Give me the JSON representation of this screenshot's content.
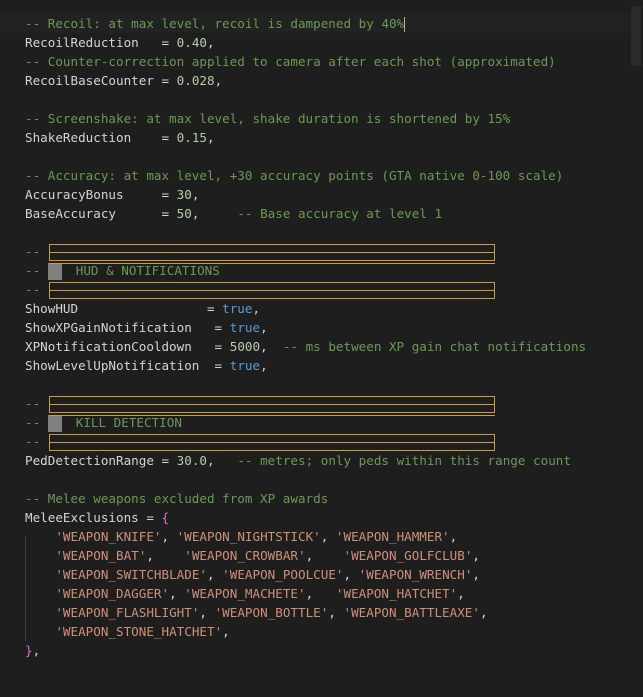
{
  "lines": {
    "l1": "-- Recoil: at max level, recoil is dampened by 40%",
    "l2_key": "RecoilReduction",
    "l2_eq": "   = ",
    "l2_val": "0.40",
    "l2_end": ",",
    "l3": "-- Counter-correction applied to camera after each shot (approximated)",
    "l4_key": "RecoilBaseCounter",
    "l4_eq": " = ",
    "l4_val": "0.028",
    "l4_end": ",",
    "l6": "-- Screenshake: at max level, shake duration is shortened by 15%",
    "l7_key": "ShakeReduction",
    "l7_eq": "    = ",
    "l7_val": "0.15",
    "l7_end": ",",
    "l9": "-- Accuracy: at max level, +30 accuracy points (GTA native 0-100 scale)",
    "l10_key": "AccuracyBonus",
    "l10_eq": "     = ",
    "l10_val": "30",
    "l10_end": ",",
    "l11_key": "BaseAccuracy",
    "l11_eq": "      = ",
    "l11_val": "50",
    "l11_end": ",     ",
    "l11_cm": "-- Base accuracy at level 1",
    "dash": "--",
    "hud_title": "HUD & NOTIFICATIONS",
    "l14_key": "ShowHUD",
    "l14_eq": "                 = ",
    "l14_val": "true",
    "l14_end": ",",
    "l15_key": "ShowXPGainNotification",
    "l15_eq": "   = ",
    "l15_val": "true",
    "l15_end": ",",
    "l16_key": "XPNotificationCooldown",
    "l16_eq": "   = ",
    "l16_val": "5000",
    "l16_end": ",  ",
    "l16_cm": "-- ms between XP gain chat notifications",
    "l17_key": "ShowLevelUpNotification",
    "l17_eq": "  = ",
    "l17_val": "true",
    "l17_end": ",",
    "kill_title": "KILL DETECTION",
    "l22_key": "PedDetectionRange",
    "l22_eq": " = ",
    "l22_val": "30.0",
    "l22_end": ",   ",
    "l22_cm": "-- metres; only peds within this range count",
    "l24": "-- Melee weapons excluded from XP awards",
    "l25_key": "MeleeExclusions",
    "l25_eq": " = ",
    "l25_brace": "{",
    "w1a": "'WEAPON_KNIFE'",
    "w1b": "'WEAPON_NIGHTSTICK'",
    "w1c": "'WEAPON_HAMMER'",
    "w2a": "'WEAPON_BAT'",
    "w2b": "'WEAPON_CROWBAR'",
    "w2c": "'WEAPON_GOLFCLUB'",
    "w3a": "'WEAPON_SWITCHBLADE'",
    "w3b": "'WEAPON_POOLCUE'",
    "w3c": "'WEAPON_WRENCH'",
    "w4a": "'WEAPON_DAGGER'",
    "w4b": "'WEAPON_MACHETE'",
    "w4c": "'WEAPON_HATCHET'",
    "w5a": "'WEAPON_FLASHLIGHT'",
    "w5b": "'WEAPON_BOTTLE'",
    "w5c": "'WEAPON_BATTLEAXE'",
    "w6a": "'WEAPON_STONE_HATCHET'",
    "l32_brace": "}",
    "l32_end": ","
  }
}
